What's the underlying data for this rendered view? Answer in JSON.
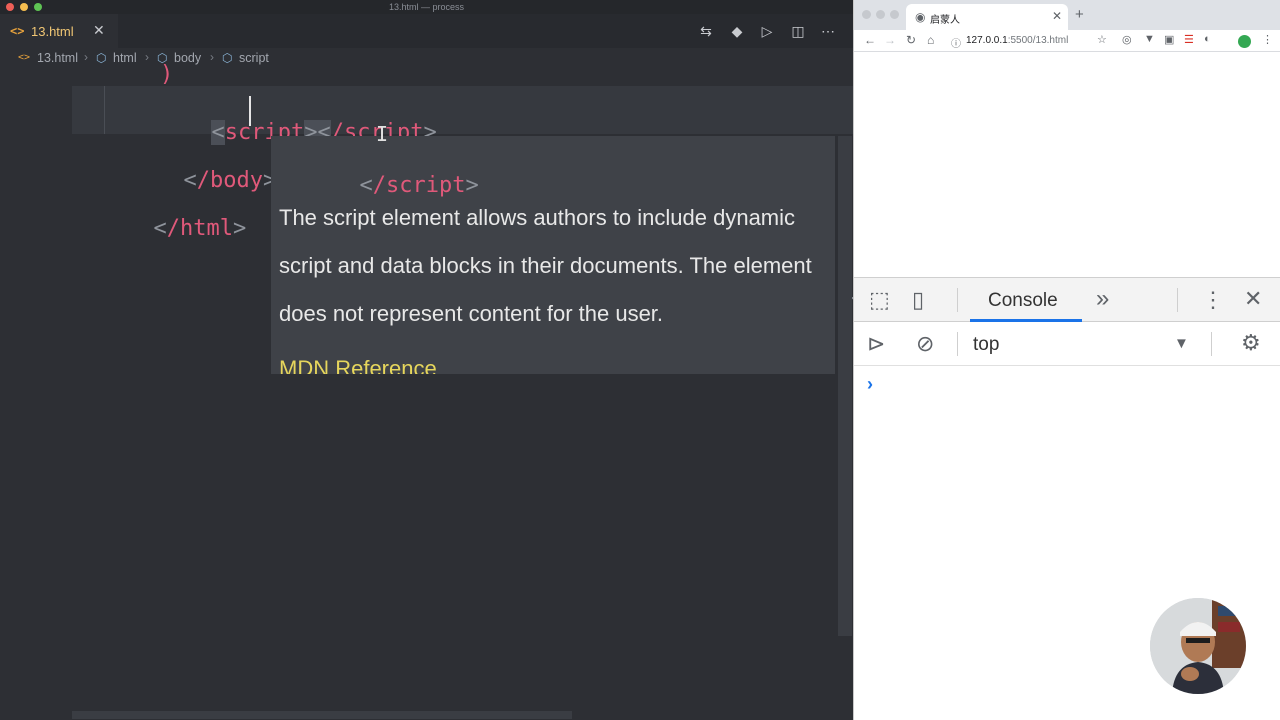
{
  "editor": {
    "window_title": "13.html — process",
    "tab": {
      "icon": "code-icon",
      "label": "13.html",
      "close": "✕"
    },
    "breadcrumb": [
      "13.html",
      "html",
      "body",
      "script"
    ],
    "code_lines": {
      "script_open": "script",
      "script_close": "/script",
      "body_close": "/body",
      "html_close": "/html"
    },
    "hover": {
      "code": "/script",
      "description": "The script element allows authors to include dynamic script and data blocks in their documents. The element does not represent content for the user.",
      "link": "MDN Reference"
    }
  },
  "browser": {
    "tab_title": "启蒙人",
    "new_tab": "+",
    "url_host": "127.0.0.1",
    "url_path": ":5500/13.html",
    "devtools": {
      "tab_console": "Console",
      "more_tabs": "»",
      "context": "top",
      "prompt": "›"
    }
  },
  "colors": {
    "tag": "#e0597a",
    "accent_blue": "#1a73e8",
    "link_yellow": "#e6d65c"
  }
}
